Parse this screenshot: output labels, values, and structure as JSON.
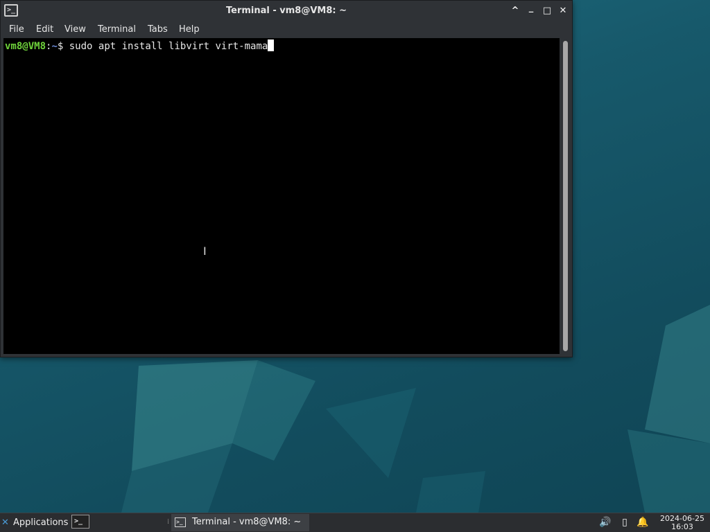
{
  "window": {
    "title": "Terminal - vm8@VM8: ~",
    "controls": {
      "shade": "^",
      "minimize": "_",
      "maximize": "□",
      "close": "✕"
    },
    "icon_glyph": ">_"
  },
  "menu": [
    {
      "label": "File"
    },
    {
      "label": "Edit"
    },
    {
      "label": "View"
    },
    {
      "label": "Terminal"
    },
    {
      "label": "Tabs"
    },
    {
      "label": "Help"
    }
  ],
  "terminal": {
    "prompt_user": "vm8@VM8",
    "prompt_sep": ":",
    "prompt_path": "~",
    "prompt_symbol": "$ ",
    "command": "sudo apt install libvirt virt-mama",
    "mouse_cursor_glyph": "I"
  },
  "taskbar": {
    "applications_label": "Applications",
    "applications_logo": "✕",
    "launcher_glyph": ">_",
    "separator_glyph": "⁞",
    "task_label": "Terminal - vm8@VM8: ~",
    "task_icon_glyph": ">_",
    "tray": {
      "volume": "🔊",
      "battery": "▯",
      "notifications": "🔔"
    },
    "clock": {
      "date": "2024-06-25",
      "time": "16:03"
    }
  },
  "colors": {
    "prompt_user": "#6fd33b",
    "prompt_path": "#6d8cd8",
    "terminal_bg": "#000000",
    "window_chrome": "#2f3236",
    "desktop": "#17596b"
  }
}
